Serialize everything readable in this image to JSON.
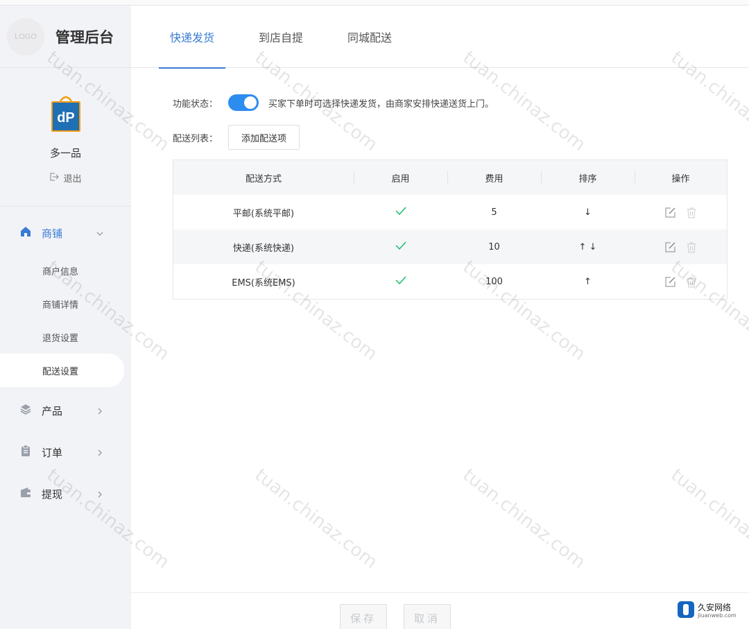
{
  "app": {
    "logo_text": "LOGO",
    "title": "管理后台"
  },
  "shop": {
    "name": "多一品",
    "logout_label": "退出"
  },
  "nav": {
    "groups": [
      {
        "label": "商铺",
        "icon": "home-icon",
        "expanded": true
      },
      {
        "label": "产品",
        "icon": "layers-icon"
      },
      {
        "label": "订单",
        "icon": "clipboard-icon"
      },
      {
        "label": "提现",
        "icon": "wallet-icon"
      }
    ],
    "sub_items": [
      "商户信息",
      "商铺详情",
      "退货设置",
      "配送设置"
    ],
    "active_sub": "配送设置"
  },
  "tabs": [
    "快递发货",
    "到店自提",
    "同城配送"
  ],
  "active_tab": "快递发货",
  "form": {
    "status_label": "功能状态：",
    "status_on": true,
    "status_desc": "买家下单时可选择快递发货，由商家安排快递送货上门。",
    "list_label": "配送列表：",
    "add_button": "添加配送项"
  },
  "table": {
    "headers": [
      "配送方式",
      "启用",
      "费用",
      "排序",
      "操作"
    ],
    "rows": [
      {
        "method": "平邮(系统平邮)",
        "enabled": true,
        "fee": "5",
        "sort": "↓"
      },
      {
        "method": "快递(系统快递)",
        "enabled": true,
        "fee": "10",
        "sort": "↑ ↓"
      },
      {
        "method": "EMS(系统EMS)",
        "enabled": true,
        "fee": "100",
        "sort": "↑"
      }
    ]
  },
  "footer": {
    "save": "保存",
    "cancel": "取消"
  },
  "watermark": "tuan.chinaz.com",
  "corner_brand": {
    "name": "久安网络",
    "domain": "Jiuanweb.com"
  },
  "colors": {
    "accent": "#3a7bd5",
    "toggle": "#2d8cf0",
    "check": "#19be6b"
  }
}
